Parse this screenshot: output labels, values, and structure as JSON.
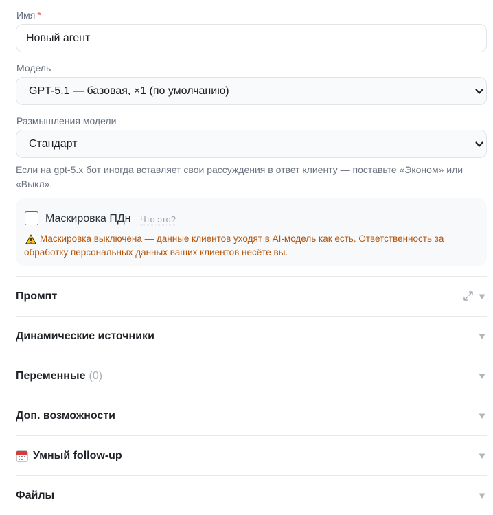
{
  "name_field": {
    "label": "Имя",
    "required_mark": "*",
    "value": "Новый агент"
  },
  "model_field": {
    "label": "Модель",
    "selected": "GPT-5.1 — базовая, ×1 (по умолчанию)"
  },
  "reasoning_field": {
    "label": "Размышления модели",
    "selected": "Стандарт",
    "hint": "Если на gpt-5.x бот иногда вставляет свои рассуждения в ответ клиенту — поставьте «Эконом» или «Выкл»."
  },
  "pii_masking": {
    "label": "Маскировка ПДн",
    "checked": false,
    "help_link": "Что это?",
    "warning": "Маскировка выключена — данные клиентов уходят в AI-модель как есть. Ответственность за обработку персональных данных ваших клиентов несёте вы.",
    "warning_color": "#b45309"
  },
  "sections": [
    {
      "title": "Промпт",
      "icon": "expand-icon"
    },
    {
      "title": "Динамические источники"
    },
    {
      "title": "Переменные",
      "count": "(0)"
    },
    {
      "title": "Доп. возможности"
    },
    {
      "title": "Умный follow-up",
      "icon": "calendar-icon"
    },
    {
      "title": "Файлы"
    }
  ]
}
